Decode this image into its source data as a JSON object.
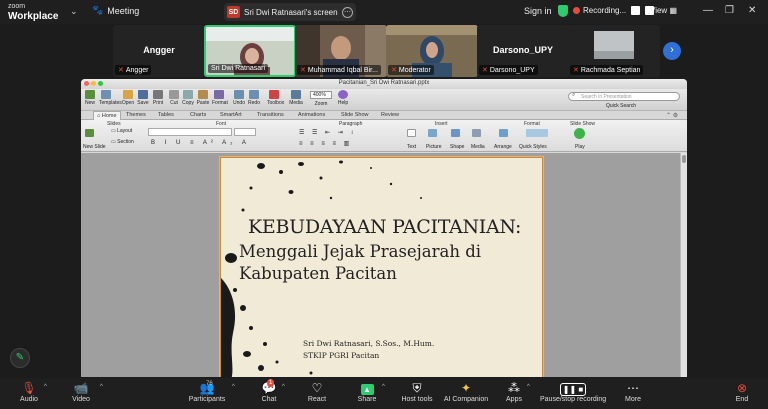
{
  "header": {
    "brand_line1": "zoom",
    "brand_line2": "Workplace",
    "meeting_label": "Meeting",
    "share_badge": "SD",
    "share_title": "Sri Dwi Ratnasari's screen",
    "sign_in": "Sign in",
    "recording": "Recording...",
    "view": "View"
  },
  "participants_strip": [
    {
      "big_name": "Angger",
      "label": "Angger",
      "muted": true
    },
    {
      "big_name": "",
      "label": "Sri Dwi Ratnasari",
      "muted": false,
      "active": true
    },
    {
      "big_name": "",
      "label": "Muhammad Iqbal Bir...",
      "muted": true
    },
    {
      "big_name": "",
      "label": "Moderator",
      "muted": true
    },
    {
      "big_name": "Darsono_UPY",
      "label": "Darsono_UPY",
      "muted": true
    },
    {
      "big_name": "",
      "label": "Rachmada Septian",
      "muted": true
    }
  ],
  "ppt": {
    "window_title": "Pacitanian_Sri Dwi Ratnasari.pptx",
    "toolbar": [
      "New",
      "Templates",
      "Open",
      "Save",
      "Print",
      "Cut",
      "Copy",
      "Paste",
      "Format",
      "Undo",
      "Redo",
      "Toolbox",
      "Media",
      "Zoom",
      "Help"
    ],
    "zoom": "400%",
    "search_placeholder": "Search in Presentation",
    "quick_search": "Quick Search",
    "tabs": [
      "Home",
      "Themes",
      "Tables",
      "Charts",
      "SmartArt",
      "Transitions",
      "Animations",
      "Slide Show",
      "Review"
    ],
    "ribbon_groups": [
      "Slides",
      "Font",
      "Paragraph",
      "Insert",
      "Format",
      "Slide Show"
    ],
    "ribbon_labels": {
      "new_slide": "New Slide",
      "layout": "Layout",
      "section": "Section",
      "text": "Text",
      "picture": "Picture",
      "shape": "Shape",
      "media": "Media",
      "arrange": "Arrange",
      "quick_styles": "Quick Styles",
      "play": "Play"
    }
  },
  "slide": {
    "title_line1": "KEBUDAYAAN PACITANIAN:",
    "title_line2": "Menggali Jejak Prasejarah di",
    "title_line3": "Kabupaten Pacitan",
    "author": "Sri Dwi Ratnasari, S.Sos., M.Hum.",
    "institution": "STKIP PGRI Pacitan"
  },
  "bottom": {
    "audio": "Audio",
    "video": "Video",
    "participants": "Participants",
    "participants_count": "76",
    "chat": "Chat",
    "chat_badge": "1",
    "react": "React",
    "share": "Share",
    "host_tools": "Host tools",
    "ai_companion": "AI Companion",
    "apps": "Apps",
    "pause_stop": "Pause/stop recording",
    "more": "More",
    "end": "End"
  },
  "colors": {
    "accent_green": "#2ecc71",
    "recording_red": "#e74c3c",
    "slide_border": "#c68a3a",
    "next_button": "#2f6fd6"
  }
}
